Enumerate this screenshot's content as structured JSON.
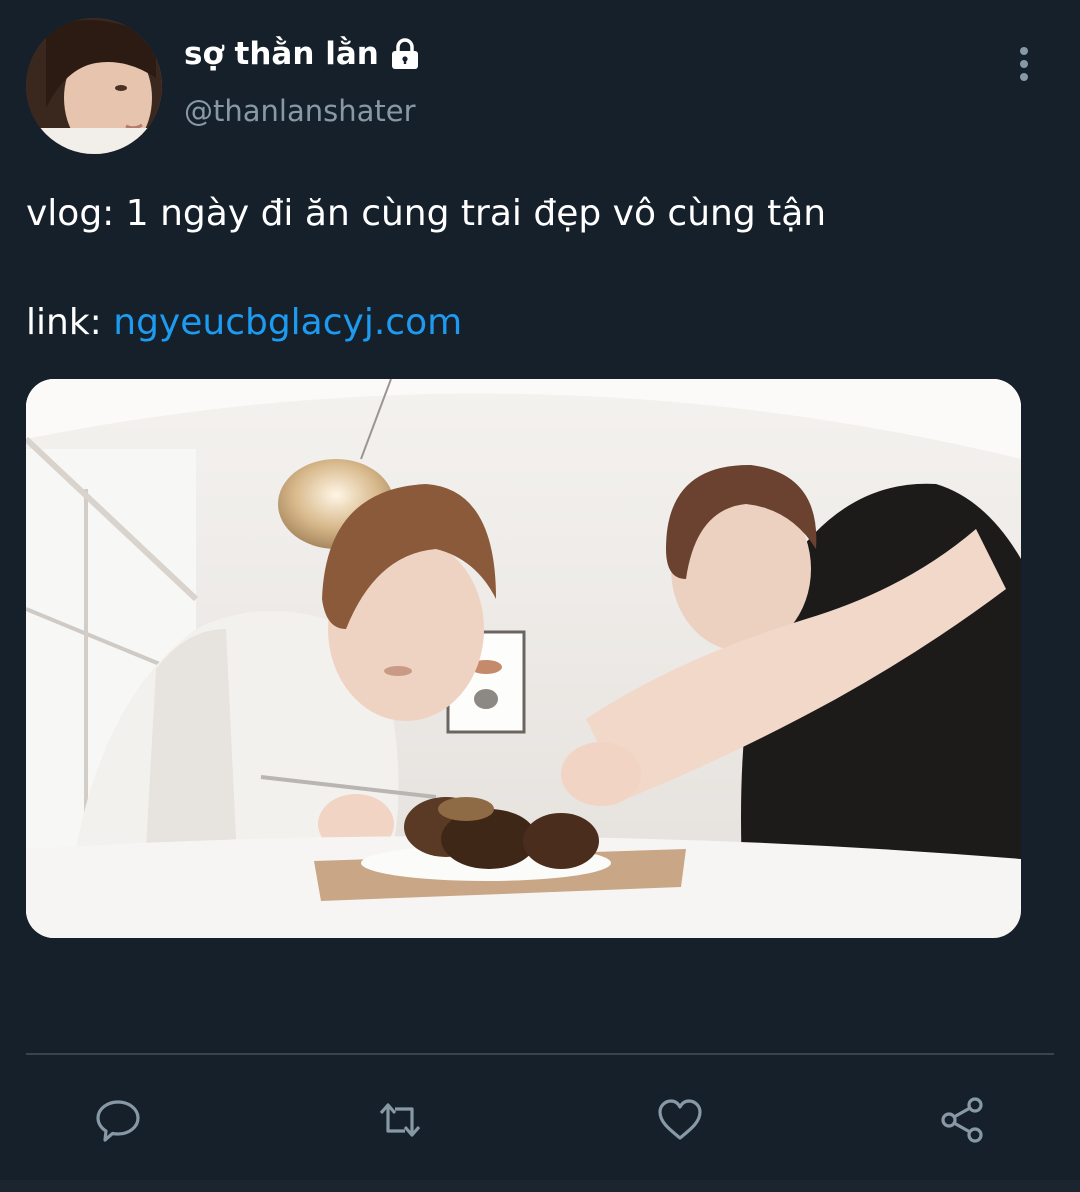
{
  "user": {
    "display_name": "sợ thằn lằn",
    "handle": "@thanlanshater",
    "protected_icon": "lock-icon"
  },
  "tweet": {
    "text": "vlog: 1 ngày đi ăn cùng trai đẹp vô cùng tận",
    "link_prefix": "link: ",
    "link_text": "ngyeucbglacyj.com"
  },
  "media": {
    "alt": "photo"
  },
  "actions": [
    {
      "name": "reply",
      "icon": "reply-icon"
    },
    {
      "name": "retweet",
      "icon": "retweet-icon"
    },
    {
      "name": "like",
      "icon": "heart-icon"
    },
    {
      "name": "share",
      "icon": "share-icon"
    }
  ],
  "colors": {
    "background": "#15202b",
    "text": "#ffffff",
    "secondary_text": "#8899a6",
    "link": "#1d9bf0",
    "icon": "#8899a6",
    "divider": "#38444d"
  }
}
